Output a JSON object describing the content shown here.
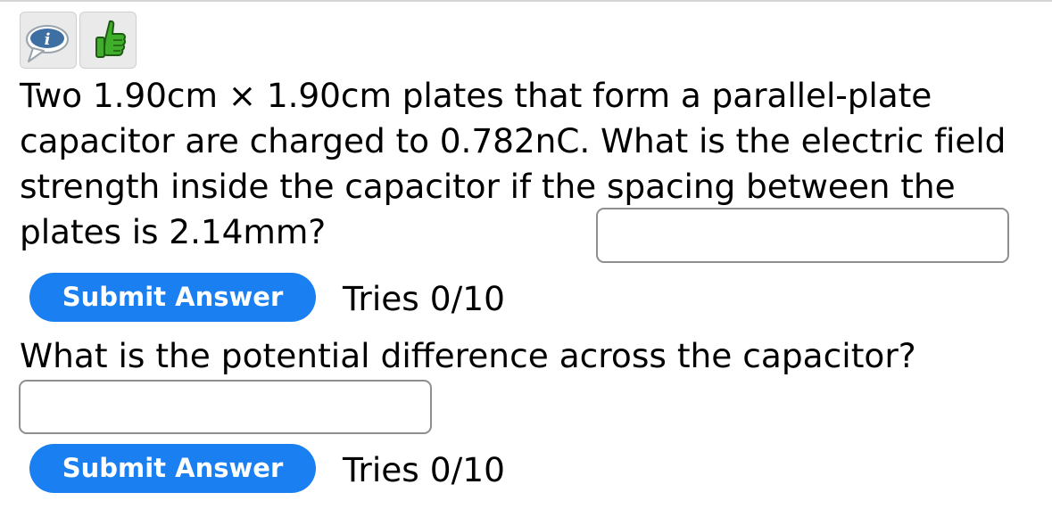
{
  "icons": {
    "info": "info-speech-bubble-icon",
    "thumb": "thumbs-up-icon"
  },
  "question1": {
    "text": "Two 1.90cm × 1.90cm plates that form a parallel-plate capacitor are charged to 0.782nC. What is the electric field strength inside the capacitor if the spacing between the plates is 2.14mm?",
    "answer_value": "",
    "submit_label": "Submit Answer",
    "tries": "Tries 0/10"
  },
  "question2": {
    "text": "What is the potential difference across the capacitor?",
    "answer_value": "",
    "submit_label": "Submit Answer",
    "tries": "Tries 0/10"
  },
  "colors": {
    "button": "#1a7ff0",
    "button_text": "#ffffff",
    "input_border": "#8f8f8f"
  }
}
